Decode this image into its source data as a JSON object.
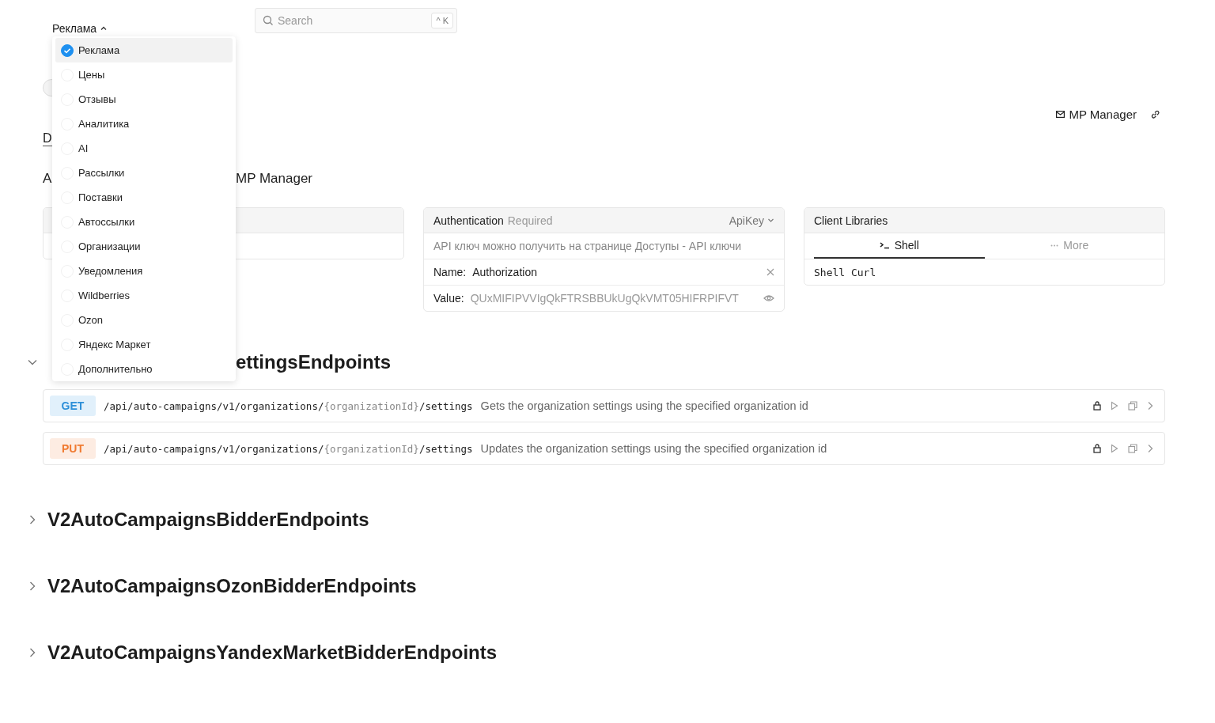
{
  "top_menu": {
    "label": "Реклама",
    "expanded": true
  },
  "search": {
    "placeholder": "Search",
    "shortcut": "^ K"
  },
  "dropdown_items": [
    {
      "label": "Реклама",
      "selected": true
    },
    {
      "label": "Цены",
      "selected": false
    },
    {
      "label": "Отзывы",
      "selected": false
    },
    {
      "label": "Аналитика",
      "selected": false
    },
    {
      "label": "AI",
      "selected": false
    },
    {
      "label": "Рассылки",
      "selected": false
    },
    {
      "label": "Поставки",
      "selected": false
    },
    {
      "label": "Автоссылки",
      "selected": false
    },
    {
      "label": "Организации",
      "selected": false
    },
    {
      "label": "Уведомления",
      "selected": false
    },
    {
      "label": "Wildberries",
      "selected": false
    },
    {
      "label": "Ozon",
      "selected": false
    },
    {
      "label": "Яндекс Маркет",
      "selected": false
    },
    {
      "label": "Дополнительно",
      "selected": false
    }
  ],
  "header": {
    "description": "D",
    "contact": "MP Manager",
    "intro_parts": [
      "A",
      "MP Manager"
    ]
  },
  "auth": {
    "title": "Authentication",
    "required": "Required",
    "scheme": "ApiKey",
    "description": "API ключ можно получить на странице Доступы - API ключи",
    "name_label": "Name:",
    "name_value": "Authorization",
    "value_label": "Value:",
    "value": "QUxMIFIPVVIgQkFTRSBBUkUgQkVMT05HIFRPIFVT"
  },
  "client_libraries": {
    "title": "Client Libraries",
    "tabs": [
      {
        "label": "Shell",
        "selected": true,
        "kind": "shell"
      },
      {
        "label": "More",
        "selected": false,
        "kind": "more"
      }
    ],
    "code": "Shell Curl"
  },
  "sections": [
    {
      "title_parts": [
        "ettingsEndpoints"
      ],
      "cut_left": true,
      "expanded": true,
      "endpoints": [
        {
          "method": "GET",
          "path_parts": [
            {
              "kind": "static",
              "text": "/api/auto-campaigns/v1/organizations/"
            },
            {
              "kind": "param",
              "text": "{organizationId}"
            },
            {
              "kind": "static",
              "text": "/settings"
            }
          ],
          "description": "Gets the organization settings using the specified organization id"
        },
        {
          "method": "PUT",
          "path_parts": [
            {
              "kind": "static",
              "text": "/api/auto-campaigns/v1/organizations/"
            },
            {
              "kind": "param",
              "text": "{organizationId}"
            },
            {
              "kind": "static",
              "text": "/settings"
            }
          ],
          "description": "Updates the organization settings using the specified organization id"
        }
      ]
    },
    {
      "title_parts": [
        "V2AutoCampaignsBidderEndpoints"
      ],
      "expanded": false
    },
    {
      "title_parts": [
        "V2AutoCampaignsOzonBidderEndpoints"
      ],
      "expanded": false
    },
    {
      "title_parts": [
        "V2AutoCampaignsYandexMarketBidderEndpoints"
      ],
      "expanded": false
    }
  ]
}
